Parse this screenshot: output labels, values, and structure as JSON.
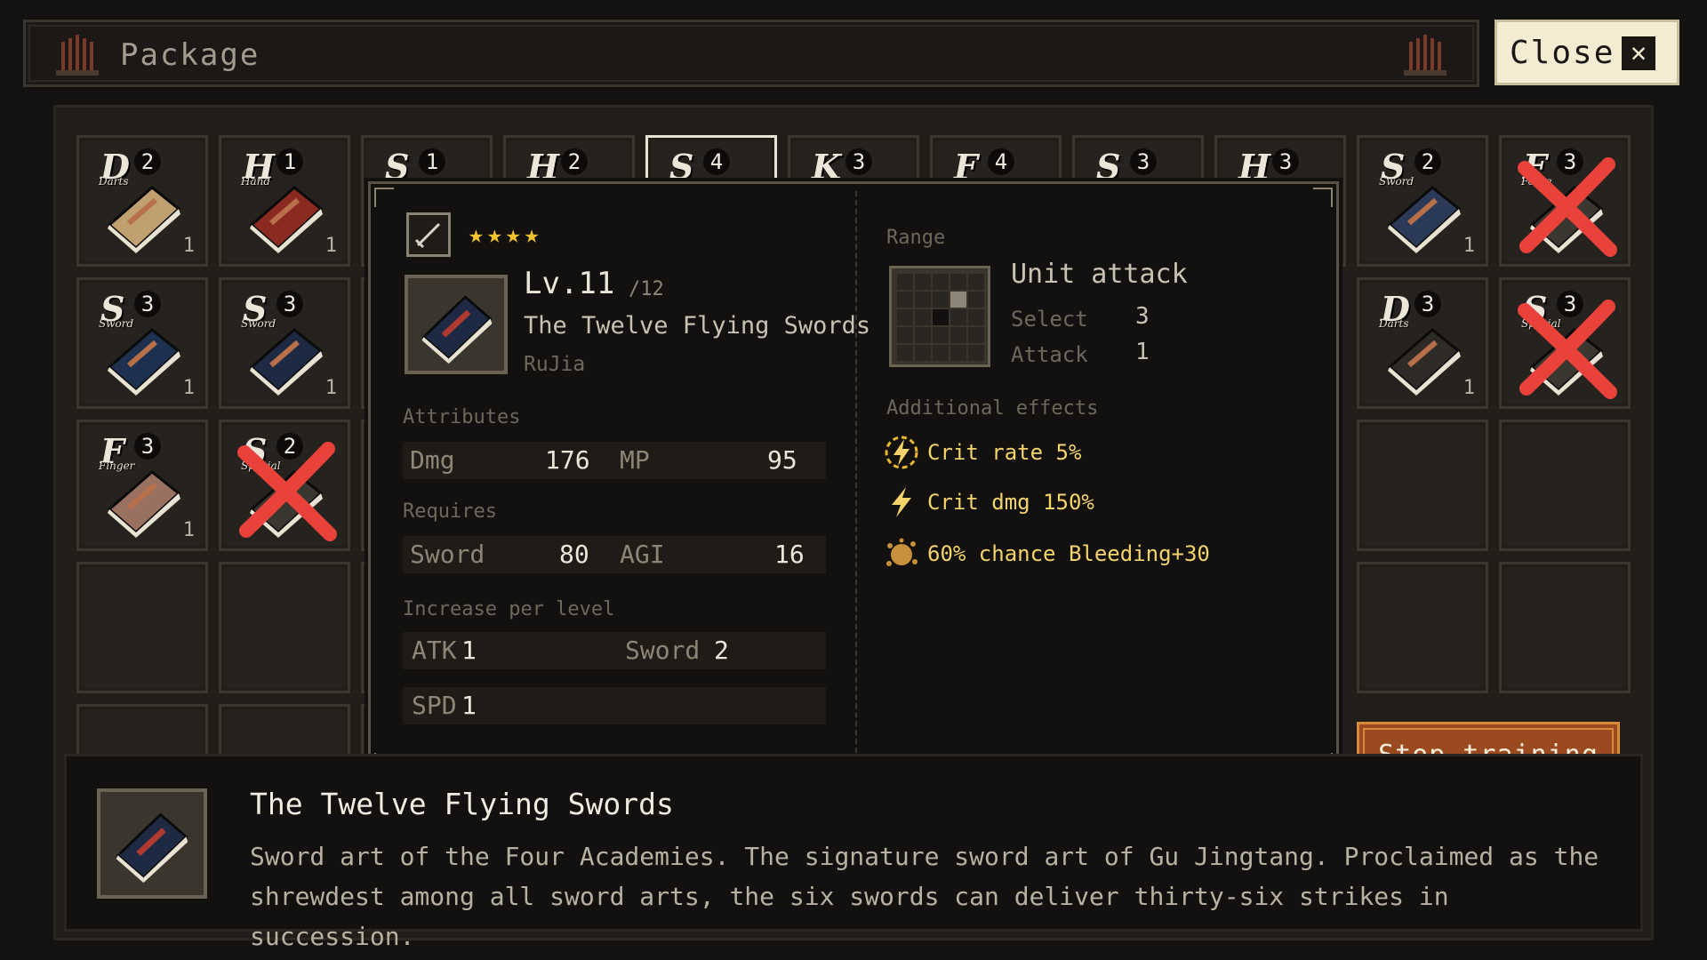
{
  "header": {
    "title": "Package",
    "close_label": "Close"
  },
  "inventory": {
    "slots": [
      {
        "grade": "D",
        "num": "2",
        "cat": "Darts",
        "qty": "1",
        "color": "#c0a070",
        "crossed": false
      },
      {
        "grade": "H",
        "num": "1",
        "cat": "Hand",
        "qty": "1",
        "color": "#8a2a20",
        "crossed": false
      },
      {
        "grade": "S",
        "num": "1",
        "cat": "",
        "qty": "",
        "color": "#2c3a5a",
        "crossed": false
      },
      {
        "grade": "H",
        "num": "2",
        "cat": "",
        "qty": "",
        "color": "#6a2a20",
        "crossed": false
      },
      {
        "grade": "S",
        "num": "4",
        "cat": "",
        "qty": "",
        "color": "#1e2a44",
        "crossed": false
      },
      {
        "grade": "K",
        "num": "3",
        "cat": "",
        "qty": "",
        "color": "#2c3a5a",
        "crossed": false
      },
      {
        "grade": "F",
        "num": "4",
        "cat": "",
        "qty": "",
        "color": "#a0907a",
        "crossed": false
      },
      {
        "grade": "S",
        "num": "3",
        "cat": "",
        "qty": "",
        "color": "#6a4a2a",
        "crossed": false
      },
      {
        "grade": "H",
        "num": "3",
        "cat": "",
        "qty": "",
        "color": "#6a2a20",
        "crossed": false
      },
      {
        "grade": "S",
        "num": "2",
        "cat": "Sword",
        "qty": "1",
        "color": "#2c3a5a",
        "crossed": false
      },
      {
        "grade": "F",
        "num": "3",
        "cat": "Force",
        "qty": "",
        "color": "#3a3630",
        "crossed": true
      },
      {
        "grade": "S",
        "num": "3",
        "cat": "Sword",
        "qty": "1",
        "color": "#1e3050",
        "crossed": false
      },
      {
        "grade": "S",
        "num": "3",
        "cat": "Sword",
        "qty": "1",
        "color": "#1e2a44",
        "crossed": false
      },
      {
        "grade": "D",
        "num": "3",
        "cat": "Darts",
        "qty": "1",
        "color": "#2e2a26",
        "crossed": false
      },
      {
        "grade": "S",
        "num": "3",
        "cat": "Special",
        "qty": "",
        "color": "#3a3630",
        "crossed": true
      },
      {
        "grade": "F",
        "num": "3",
        "cat": "Finger",
        "qty": "1",
        "color": "#9a7060",
        "crossed": false
      },
      {
        "grade": "S",
        "num": "2",
        "cat": "Special",
        "qty": "",
        "color": "#3a3630",
        "crossed": true
      }
    ]
  },
  "detail": {
    "stars": "★★★★",
    "level": "Lv.11",
    "level_max": "/12",
    "name": "The Twelve Flying Swords",
    "school": "RuJia",
    "attributes_label": "Attributes",
    "attributes": {
      "dmg_label": "Dmg",
      "dmg": "176",
      "mp_label": "MP",
      "mp": "95"
    },
    "requires_label": "Requires",
    "requires": {
      "k1": "Sword",
      "v1": "80",
      "k2": "AGI",
      "v2": "16"
    },
    "increase_label": "Increase per level",
    "increase": [
      {
        "k1": "ATK",
        "v1": "1",
        "k2": "Sword",
        "v2": "2"
      },
      {
        "k1": "SPD",
        "v1": "1"
      }
    ],
    "range_label": "Range",
    "range_title": "Unit attack",
    "select_label": "Select",
    "select_value": "3",
    "attack_label": "Attack",
    "attack_value": "1",
    "effects_label": "Additional effects",
    "effects": [
      {
        "text": "Crit rate 5%",
        "icon": "crit-rate-icon"
      },
      {
        "text": "Crit dmg 150%",
        "icon": "lightning-icon"
      },
      {
        "text": "60% chance Bleeding+30",
        "icon": "bleed-icon"
      }
    ]
  },
  "stop_training_label": "Stop training",
  "description": {
    "title": "The Twelve Flying Swords",
    "text": "Sword art of the Four Academies. The signature sword art of Gu Jingtang. Proclaimed as the shrewdest among all sword arts, the six swords can deliver thirty-six strikes in succession."
  },
  "colors": {
    "star": "#f2c230",
    "effect": "#f3d36a",
    "stop_btn": "#9a4a1e",
    "x_mark": "#e8423a"
  }
}
